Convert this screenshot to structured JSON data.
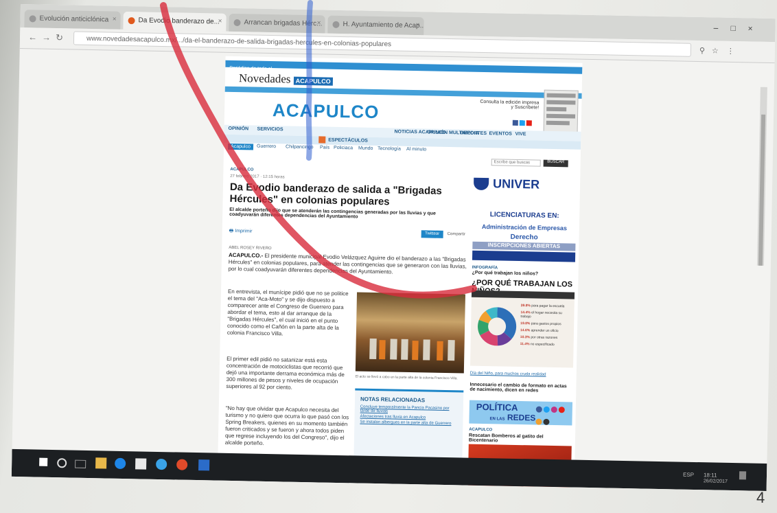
{
  "browser": {
    "tabs": [
      {
        "label": "Evolución anticiclónica"
      },
      {
        "label": "Da Evodio banderazo de..."
      },
      {
        "label": "Arrancan brigadas Hérc..."
      },
      {
        "label": "H. Ayuntamiento de Acap..."
      }
    ],
    "url": "www.novedadesacapulco.mx/.../da-el-banderazo-de-salida-brigadas-hercules-en-colonias-populares",
    "window_controls": {
      "minimize": "–",
      "maximize": "□",
      "close": "×"
    }
  },
  "site": {
    "top_bar_text": "Periódico de todo el...",
    "logo_text": "Novedades",
    "logo_badge": "ACAPULCO",
    "logo_big": "ACAPULCO",
    "edition_text": "Consulta la edición impresa y Suscríbete!",
    "nav_items": [
      "OPINIÓN",
      "SERVICIOS",
      "NOTICIAS ACAPULCO",
      "OPINIÓN MULTIMEDIA",
      "DEPORTES",
      "EVENTOS",
      "VIVE"
    ],
    "nav2_items": [
      "ESPECTÁCULOS"
    ],
    "subnav": [
      "Acapulco",
      "Guerrero",
      "Chilpancingo",
      "País",
      "Policiaca",
      "Mundo",
      "Tecnología",
      "Al minuto"
    ],
    "search_placeholder": "Escribe que buscas",
    "search_button": "BUSCAR"
  },
  "article": {
    "section": "ACAPULCO",
    "date": "27 febrero 2017 · 12:15 horas",
    "headline": "Da Evodio banderazo de salida a \"Brigadas Hércules\" en colonias populares",
    "dek": "El alcalde porteño dijo que se atenderán las contingencias generadas por las lluvias y que coadyuvarán diferentes dependencias del Ayuntamiento",
    "print_label": "Imprimir",
    "tweet_label": "Twittear",
    "share_label": "Compartir",
    "byline": "ABEL ROSEY RIVERO",
    "lead_city": "ACAPULCO.-",
    "lead": "El presidente municipal Evodio Velázquez Aguirre dio el banderazo a las \"Brigadas Hércules\" en colonias populares, para atender las contingencias que se generaron con las lluvias, por lo cual coadyuvarán diferentes dependencias del Ayuntamiento.",
    "p1": "En entrevista, el munícipe pidió que no se politice el tema del \"Aca-Moto\" y se dijo dispuesto a comparecer ante el Congreso de Guerrero para abordar el tema, esto al dar arranque de la \"Brigadas Hércules\", el cual inició en el punto conocido como el Cañón en la parte alta de la colonia Francisco Villa.",
    "p2": "El primer edil pidió no satanizar está esta concentración de motociclistas que recorrió que dejó una importante derrama económica más de 300 millones de pesos y niveles de ocupación superiores al 92 por ciento.",
    "p3": "\"No hay que olvidar que Acapulco necesita del turismo y no quiero que ocurra lo que pasó con los Spring Breakers, quienes en su momento también fueron criticados y se fueron y ahora todos piden que regrese incluyendo los del Congreso\", dijo el alcalde porteño.",
    "photo_caption": "El acto se llevó a cabo en la parte alta de la colonia Francisco Villa.",
    "related_title": "NOTAS RELACIONADAS",
    "related_links": [
      "Concluye temporalmente la Pancia Pacasino por tarde de lluvias",
      "Afectaciones tras lluvia en Acapulco",
      "Se instalan albergues en la parte alta de Guerrero"
    ]
  },
  "sidebar": {
    "ad_brand": "UNIVER",
    "ad_licenciaturas": "LICENCIATURAS EN:",
    "ad_adm": "Administración de Empresas",
    "ad_derecho": "Derecho",
    "ad_inscripciones": "INSCRIPCIONES ABIERTAS",
    "info_section": "INFOGRAFÍA",
    "info_question": "¿Por qué trabajan los niños?",
    "info_title": "¿POR QUÉ TRABAJAN LOS NIÑOS?",
    "info_legend": [
      {
        "pct": "39.8%",
        "text": "para pagar la escuela"
      },
      {
        "pct": "14.4%",
        "text": "el hogar necesita su trabajo"
      },
      {
        "pct": "19.8%",
        "text": "para gastos propios"
      },
      {
        "pct": "14.6%",
        "text": "aprender un oficio"
      },
      {
        "pct": "10.3%",
        "text": "por otras razones"
      },
      {
        "pct": "11.4%",
        "text": "no especificado"
      }
    ],
    "info_colors": [
      "#2d6fb8",
      "#6a3d9a",
      "#d8436f",
      "#33a36b",
      "#f0a030",
      "#3fb8c8"
    ],
    "link1": "Día del Niño, para muchos cruda realidad",
    "story2": "Innecesario el cambio de formato en actas de nacimiento, dicen en redes",
    "politica_t1": "POLÍTICA",
    "politica_t2_small": "EN LAS",
    "politica_t2": "REDES",
    "acap_label": "ACAPULCO",
    "story3": "Rescatan Bomberos al gatito del Bicentenario"
  },
  "taskbar": {
    "tray_text": "ESP",
    "time": "18:11",
    "date": "26/02/2017"
  },
  "page_number": "4"
}
